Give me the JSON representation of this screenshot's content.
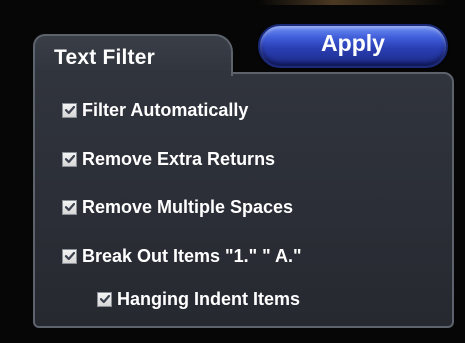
{
  "panel": {
    "tab_title": "Text Filter",
    "apply_label": "Apply"
  },
  "options": [
    {
      "label": "Filter Automatically",
      "checked": true
    },
    {
      "label": "Remove Extra Returns",
      "checked": true
    },
    {
      "label": "Remove Multiple Spaces",
      "checked": true
    },
    {
      "label": "Break Out Items \"1.\" \" A.\"",
      "checked": true
    },
    {
      "label": "Hanging Indent Items",
      "checked": true
    }
  ],
  "icons": {
    "checkbox_checked": "checkmark-icon"
  },
  "colors": {
    "panel_bg": "#2b2e36",
    "panel_border": "#5d636d",
    "apply_button": "#2a3fb4",
    "text": "#ffffff",
    "check_mark": "#3d4250"
  }
}
